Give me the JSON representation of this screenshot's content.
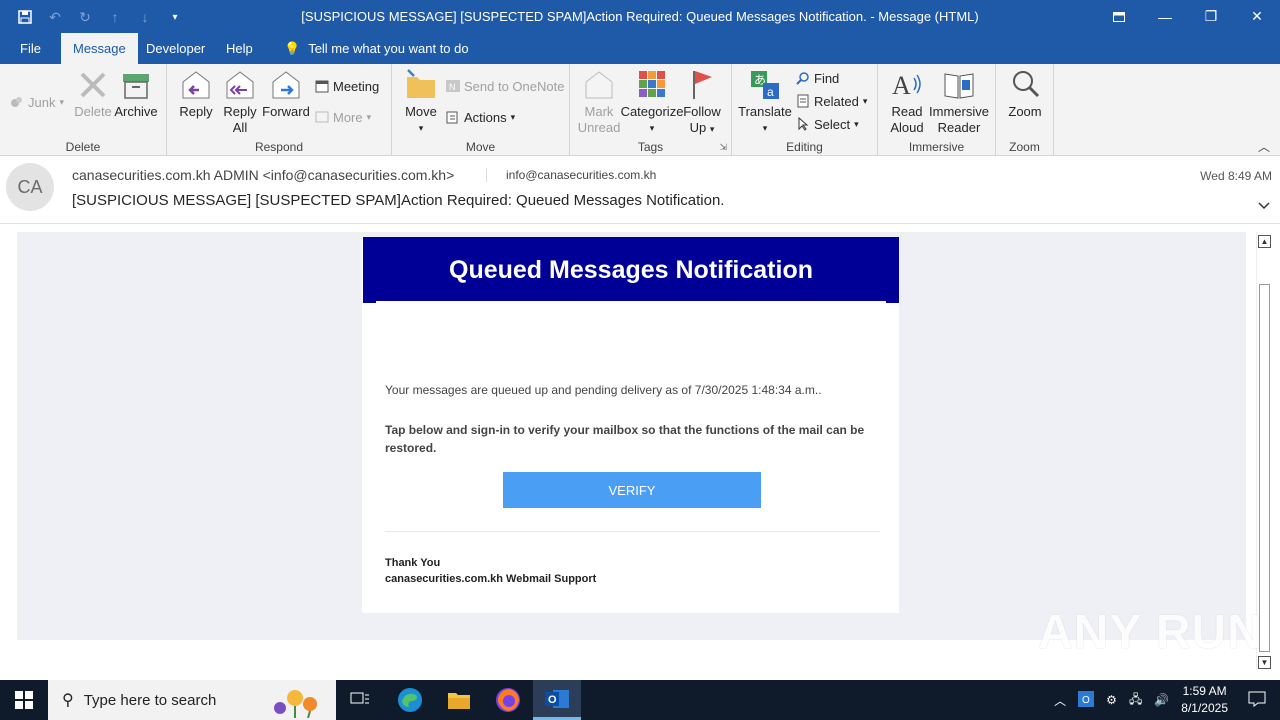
{
  "window": {
    "title": "[SUSPICIOUS MESSAGE] [SUSPECTED SPAM]Action Required: Queued Messages Notification.  -  Message (HTML)"
  },
  "tabs": [
    {
      "label": "File"
    },
    {
      "label": "Message"
    },
    {
      "label": "Developer"
    },
    {
      "label": "Help"
    },
    {
      "label": "Tell me what you want to do"
    }
  ],
  "ribbon": {
    "junk": "Junk",
    "delete": "Delete",
    "archive": "Archive",
    "group_delete": "Delete",
    "reply": "Reply",
    "reply_all_1": "Reply",
    "reply_all_2": "All",
    "forward": "Forward",
    "meeting": "Meeting",
    "more": "More",
    "group_respond": "Respond",
    "move": "Move",
    "send_onenote": "Send to OneNote",
    "actions": "Actions",
    "group_move": "Move",
    "mark_unread_1": "Mark",
    "mark_unread_2": "Unread",
    "categorize": "Categorize",
    "follow_up_1": "Follow",
    "follow_up_2": "Up",
    "group_tags": "Tags",
    "translate": "Translate",
    "find": "Find",
    "related": "Related",
    "select": "Select",
    "group_editing": "Editing",
    "read_aloud_1": "Read",
    "read_aloud_2": "Aloud",
    "immersive_1": "Immersive",
    "immersive_2": "Reader",
    "group_immersive": "Immersive",
    "zoom": "Zoom",
    "group_zoom": "Zoom"
  },
  "header": {
    "avatar_initials": "CA",
    "from": "canasecurities.com.kh ADMIN <info@canasecurities.com.kh>",
    "to": "info@canasecurities.com.kh",
    "date": "Wed 8:49 AM",
    "subject": "[SUSPICIOUS MESSAGE] [SUSPECTED SPAM]Action Required: Queued Messages Notification."
  },
  "email": {
    "heading": "Queued Messages Notification",
    "para1": "Your messages are queued up and pending delivery as of 7/30/2025 1:48:34 a.m..",
    "para2": "Tap below and sign-in to verify your mailbox so that the functions of the mail can be restored.",
    "button": "VERIFY",
    "thanks": "Thank You",
    "signature": "canasecurities.com.kh Webmail Support"
  },
  "watermark": "ANY RUN",
  "taskbar": {
    "search_placeholder": "Type here to search",
    "time": "1:59 AM",
    "date": "8/1/2025"
  },
  "colors": {
    "titlebar": "#1e5aa8",
    "email_header": "#000096",
    "verify_button": "#4a9ff5"
  }
}
